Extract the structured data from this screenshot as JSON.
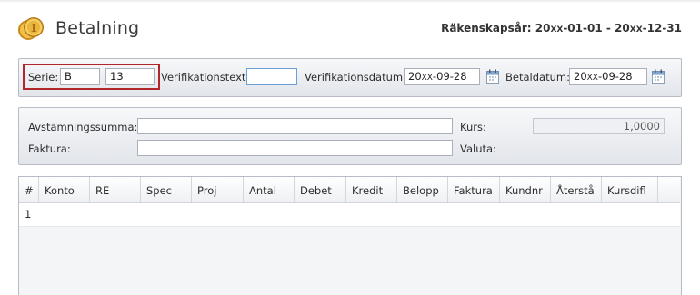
{
  "header": {
    "title": "Betalning",
    "fiscal_label": "Räkenskapsår:",
    "fiscal_start_prefix": "20",
    "fiscal_start_xx": "XX",
    "fiscal_start_suffix": "-01-01",
    "fiscal_separator": "-",
    "fiscal_end_prefix": "20",
    "fiscal_end_xx": "XX",
    "fiscal_end_suffix": "-12-31"
  },
  "form": {
    "serie_label": "Serie:",
    "serie_value": "B",
    "serie_number": "13",
    "verification_text_label": "Verifikationstext:",
    "verification_text_value": "",
    "verification_date_label": "Verifikationsdatum:",
    "verification_date_prefix": "20",
    "verification_date_xx": "XX",
    "verification_date_suffix": "-09-28",
    "pay_date_label": "Betaldatum:",
    "pay_date_prefix": "20",
    "pay_date_xx": "XX",
    "pay_date_suffix": "-09-28"
  },
  "details": {
    "reconcile_label": "Avstämningssumma:",
    "reconcile_value": "",
    "invoice_label": "Faktura:",
    "invoice_value": "",
    "rate_label": "Kurs:",
    "rate_value": "1,0000",
    "currency_label": "Valuta:"
  },
  "grid": {
    "columns": [
      "#",
      "Konto",
      "RE",
      "Spec",
      "Proj",
      "Antal",
      "Debet",
      "Kredit",
      "Belopp",
      "Faktura",
      "Kundnr",
      "Återstå",
      "Kursdifl"
    ],
    "rows": [
      {
        "num": "1"
      }
    ]
  },
  "colors": {
    "highlight_border": "#b0262a",
    "panel_gradient_top": "#f7f8fa",
    "panel_gradient_bottom": "#e2e5ea",
    "focus_border": "#6aa0d8"
  },
  "icons": {
    "app": "coins-icon",
    "date_picker": "calendar-icon"
  }
}
